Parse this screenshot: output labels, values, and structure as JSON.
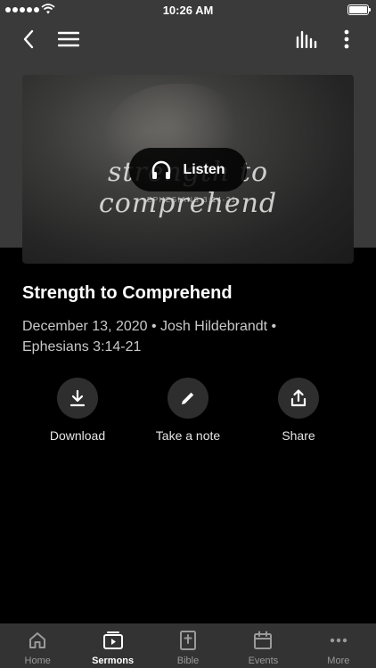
{
  "status_bar": {
    "time": "10:26 AM"
  },
  "sermon": {
    "artwork_script": "strength to comprehend",
    "artwork_reference": "EPHESIANS 3:14-21",
    "listen_label": "Listen",
    "title": "Strength to Comprehend",
    "meta_line1": "December 13, 2020 • Josh Hildebrandt •",
    "meta_line2": "Ephesians 3:14-21"
  },
  "actions": {
    "download": "Download",
    "note": "Take a note",
    "share": "Share"
  },
  "tabs": [
    {
      "label": "Home",
      "icon": "home-icon"
    },
    {
      "label": "Sermons",
      "icon": "sermons-icon",
      "active": true
    },
    {
      "label": "Bible",
      "icon": "bible-icon"
    },
    {
      "label": "Events",
      "icon": "calendar-icon"
    },
    {
      "label": "More",
      "icon": "more-icon"
    }
  ]
}
